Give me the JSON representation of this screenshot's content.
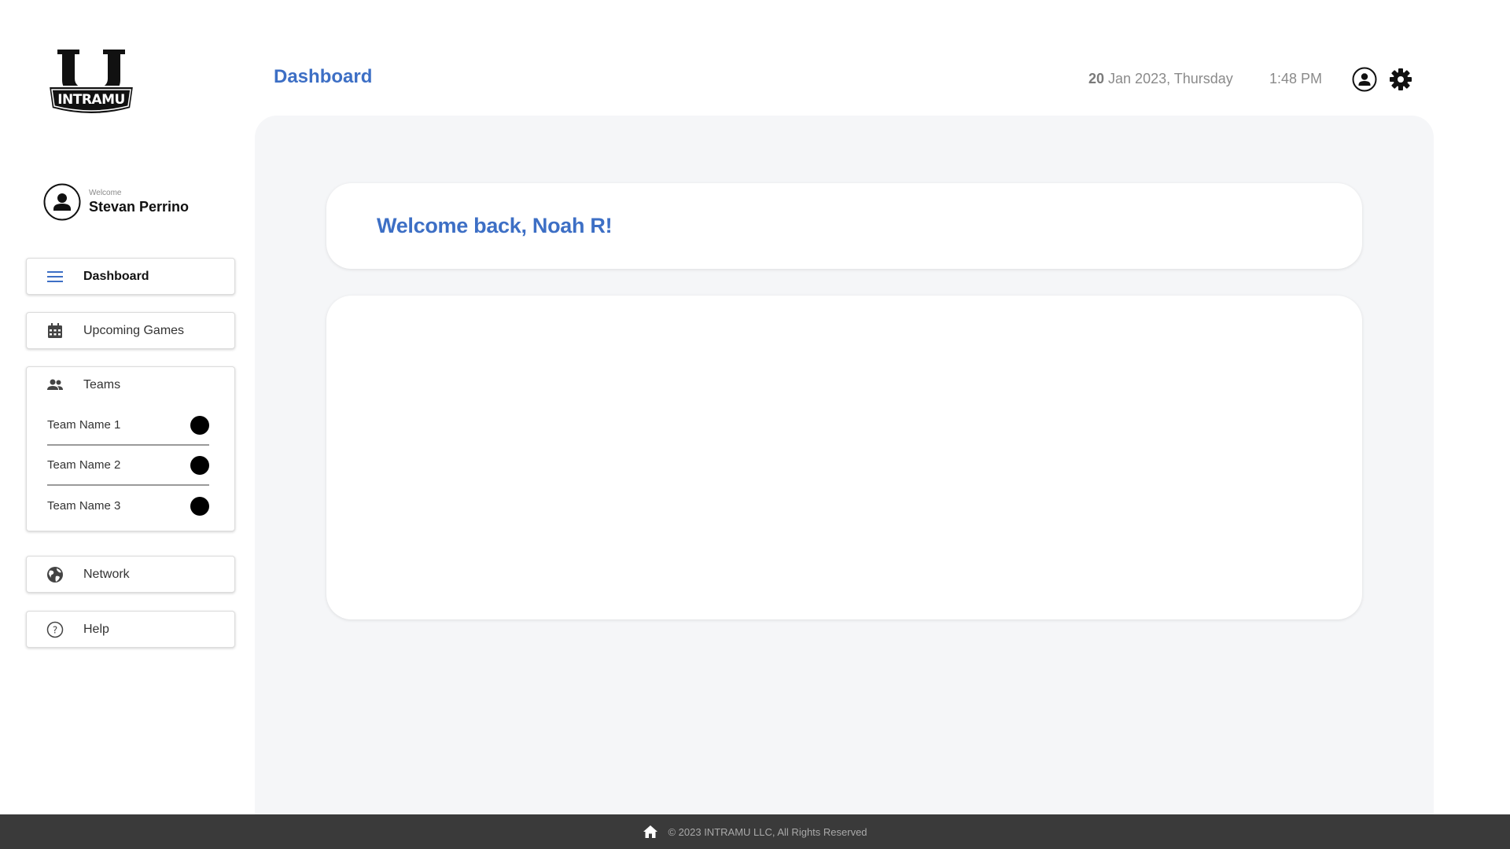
{
  "brand": {
    "logo_text": "INTRAMU",
    "logo_letter": "U"
  },
  "user": {
    "welcome_label": "Welcome",
    "name": "Stevan Perrino"
  },
  "sidebar": {
    "dashboard_label": "Dashboard",
    "upcoming_label": "Upcoming Games",
    "teams_label": "Teams",
    "teams": [
      {
        "name": "Team Name 1"
      },
      {
        "name": "Team Name 2"
      },
      {
        "name": "Team Name 3"
      }
    ],
    "network_label": "Network",
    "help_label": "Help"
  },
  "header": {
    "title": "Dashboard",
    "date_day": "20",
    "date_rest": " Jan 2023, Thursday",
    "time": "1:48 PM"
  },
  "main": {
    "welcome_message": "Welcome back, Noah R!"
  },
  "footer": {
    "copyright": "© 2023 INTRAMU LLC, All Rights Reserved"
  },
  "colors": {
    "accent": "#3d6fc5",
    "panel_bg": "#f5f6f8",
    "footer_bg": "#3a3a3a"
  },
  "icons": {
    "dashboard": "menu-icon",
    "upcoming": "calendar-icon",
    "teams": "people-icon",
    "network": "globe-icon",
    "help": "help-icon",
    "account": "account-circle-icon",
    "settings": "gear-icon",
    "footer_home": "home-icon"
  }
}
